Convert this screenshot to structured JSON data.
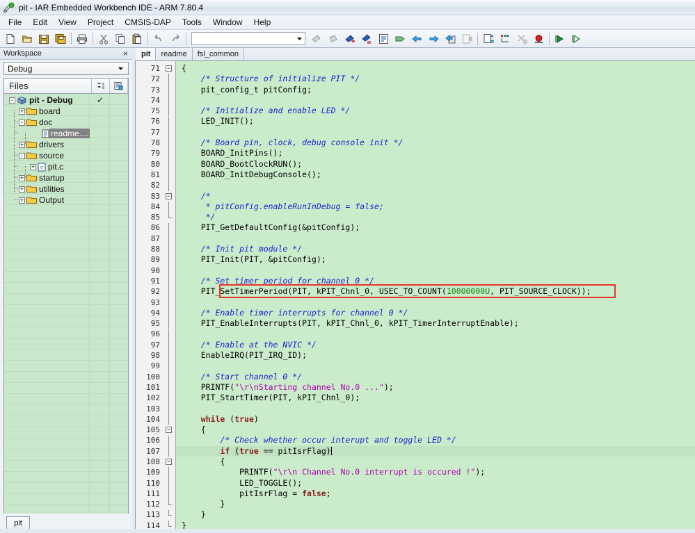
{
  "window": {
    "title": "pit - IAR Embedded Workbench IDE - ARM 7.80.4",
    "icon": "iar-app-icon"
  },
  "menu": {
    "items": [
      {
        "label": "File",
        "name": "menu-file"
      },
      {
        "label": "Edit",
        "name": "menu-edit"
      },
      {
        "label": "View",
        "name": "menu-view"
      },
      {
        "label": "Project",
        "name": "menu-project"
      },
      {
        "label": "CMSIS-DAP",
        "name": "menu-cmsis-dap"
      },
      {
        "label": "Tools",
        "name": "menu-tools"
      },
      {
        "label": "Window",
        "name": "menu-window"
      },
      {
        "label": "Help",
        "name": "menu-help"
      }
    ]
  },
  "toolbar": {
    "search_value": "",
    "search_placeholder": "",
    "buttons": [
      {
        "icon": "new-document-icon",
        "name": "toolbar-new"
      },
      {
        "icon": "open-folder-icon",
        "name": "toolbar-open"
      },
      {
        "icon": "save-icon",
        "name": "toolbar-save"
      },
      {
        "icon": "save-all-icon",
        "name": "toolbar-save-all"
      },
      {
        "icon": "print-icon",
        "name": "toolbar-print"
      },
      {
        "icon": "cut-scissors-icon",
        "name": "toolbar-cut"
      },
      {
        "icon": "copy-icon",
        "name": "toolbar-copy"
      },
      {
        "icon": "paste-icon",
        "name": "toolbar-paste"
      },
      {
        "icon": "undo-arrow-icon",
        "name": "toolbar-undo"
      },
      {
        "icon": "redo-arrow-icon",
        "name": "toolbar-redo"
      },
      {
        "icon": "bookmark-toggle-icon",
        "name": "toolbar-toggle-bookmark"
      },
      {
        "icon": "bookmark-prev-icon",
        "name": "toolbar-previous-bookmark"
      },
      {
        "icon": "breakpoint-add-icon",
        "name": "toolbar-toggle-breakpoint"
      },
      {
        "icon": "breakpoint-list-icon",
        "name": "toolbar-breakpoints"
      },
      {
        "icon": "compile-icon",
        "name": "toolbar-compile"
      },
      {
        "icon": "make-icon",
        "name": "toolbar-make"
      },
      {
        "icon": "navigate-back-icon",
        "name": "toolbar-navigate-backward"
      },
      {
        "icon": "navigate-forward-icon",
        "name": "toolbar-navigate-forward"
      },
      {
        "icon": "go-to-definition-icon",
        "name": "toolbar-go-to-definition"
      },
      {
        "icon": "next-statement-icon",
        "name": "toolbar-next-statement"
      },
      {
        "icon": "download-debug-icon",
        "name": "toolbar-download-and-debug"
      },
      {
        "icon": "debug-without-download-icon",
        "name": "toolbar-debug-without-downloading"
      },
      {
        "icon": "stop-build-icon",
        "name": "toolbar-stop-build"
      },
      {
        "icon": "stop-debug-icon",
        "name": "toolbar-stop-debugging"
      },
      {
        "icon": "run-icon",
        "name": "toolbar-run"
      },
      {
        "icon": "step-icon",
        "name": "toolbar-step"
      }
    ]
  },
  "workspace": {
    "panel_title": "Workspace",
    "close_label": "×",
    "configuration": "Debug",
    "columns": {
      "files": "Files",
      "col2_icon": "build-status-icon",
      "col3_icon": "file-overview-icon"
    },
    "tree": [
      {
        "label": "pit - Debug",
        "indent": 0,
        "expander": "-",
        "icon": "project-icon",
        "selected": false,
        "checked": true
      },
      {
        "label": "board",
        "indent": 1,
        "expander": "+",
        "icon": "folder-icon",
        "selected": false,
        "checked": false
      },
      {
        "label": "doc",
        "indent": 1,
        "expander": "-",
        "icon": "folder-icon",
        "selected": false,
        "checked": false
      },
      {
        "label": "readme....",
        "indent": 2,
        "expander": "",
        "icon": "document-icon",
        "selected": true,
        "checked": false
      },
      {
        "label": "drivers",
        "indent": 1,
        "expander": "+",
        "icon": "folder-icon",
        "selected": false,
        "checked": false
      },
      {
        "label": "source",
        "indent": 1,
        "expander": "-",
        "icon": "folder-icon",
        "selected": false,
        "checked": false
      },
      {
        "label": "pit.c",
        "indent": 2,
        "expander": "+",
        "icon": "c-source-icon",
        "selected": false,
        "checked": false
      },
      {
        "label": "startup",
        "indent": 1,
        "expander": "+",
        "icon": "folder-icon",
        "selected": false,
        "checked": false
      },
      {
        "label": "utilities",
        "indent": 1,
        "expander": "+",
        "icon": "folder-icon",
        "selected": false,
        "checked": false
      },
      {
        "label": "Output",
        "indent": 1,
        "expander": "+",
        "icon": "folder-icon",
        "selected": false,
        "checked": false
      }
    ],
    "bottom_tabs": [
      {
        "label": "pit",
        "active": true
      }
    ]
  },
  "editor": {
    "tabs": [
      {
        "label": "pit",
        "active": true
      },
      {
        "label": "readme",
        "active": false
      },
      {
        "label": "fsl_common",
        "active": false
      }
    ],
    "first_line": 71,
    "current_line": 107,
    "annotation": {
      "type": "red-rectangle",
      "around_line": 92
    },
    "lines": [
      {
        "n": 71,
        "fold": "minus",
        "segs": [
          {
            "t": "{",
            "c": ""
          }
        ],
        "indent": 0
      },
      {
        "n": 72,
        "fold": "bar",
        "segs": [
          {
            "t": "    /* Structure of initialize PIT */",
            "c": "cmt"
          }
        ]
      },
      {
        "n": 73,
        "fold": "bar",
        "segs": [
          {
            "t": "    pit_config_t pitConfig;",
            "c": ""
          }
        ]
      },
      {
        "n": 74,
        "fold": "bar",
        "segs": [
          {
            "t": "",
            "c": ""
          }
        ]
      },
      {
        "n": 75,
        "fold": "bar",
        "segs": [
          {
            "t": "    /* Initialize and enable LED */",
            "c": "cmt"
          }
        ]
      },
      {
        "n": 76,
        "fold": "bar",
        "segs": [
          {
            "t": "    LED_INIT();",
            "c": ""
          }
        ]
      },
      {
        "n": 77,
        "fold": "bar",
        "segs": [
          {
            "t": "",
            "c": ""
          }
        ]
      },
      {
        "n": 78,
        "fold": "bar",
        "segs": [
          {
            "t": "    /* Board pin, clock, debug console init */",
            "c": "cmt"
          }
        ]
      },
      {
        "n": 79,
        "fold": "bar",
        "segs": [
          {
            "t": "    BOARD_InitPins();",
            "c": ""
          }
        ]
      },
      {
        "n": 80,
        "fold": "bar",
        "segs": [
          {
            "t": "    BOARD_BootClockRUN();",
            "c": ""
          }
        ]
      },
      {
        "n": 81,
        "fold": "bar",
        "segs": [
          {
            "t": "    BOARD_InitDebugConsole();",
            "c": ""
          }
        ]
      },
      {
        "n": 82,
        "fold": "bar",
        "segs": [
          {
            "t": "",
            "c": ""
          }
        ]
      },
      {
        "n": 83,
        "fold": "minus",
        "segs": [
          {
            "t": "    /*",
            "c": "cmt"
          }
        ]
      },
      {
        "n": 84,
        "fold": "bar",
        "segs": [
          {
            "t": "     * pitConfig.enableRunInDebug = false;",
            "c": "cmt"
          }
        ]
      },
      {
        "n": 85,
        "fold": "tick",
        "segs": [
          {
            "t": "     */",
            "c": "cmt"
          }
        ]
      },
      {
        "n": 86,
        "fold": "bar",
        "segs": [
          {
            "t": "    PIT_GetDefaultConfig(&pitConfig);",
            "c": ""
          }
        ]
      },
      {
        "n": 87,
        "fold": "bar",
        "segs": [
          {
            "t": "",
            "c": ""
          }
        ]
      },
      {
        "n": 88,
        "fold": "bar",
        "segs": [
          {
            "t": "    /* Init pit module */",
            "c": "cmt"
          }
        ]
      },
      {
        "n": 89,
        "fold": "bar",
        "segs": [
          {
            "t": "    PIT_Init(PIT, &pitConfig);",
            "c": ""
          }
        ]
      },
      {
        "n": 90,
        "fold": "bar",
        "segs": [
          {
            "t": "",
            "c": ""
          }
        ]
      },
      {
        "n": 91,
        "fold": "bar",
        "segs": [
          {
            "t": "    /* Set timer period for channel 0 */",
            "c": "cmt"
          }
        ]
      },
      {
        "n": 92,
        "fold": "bar",
        "segs": [
          {
            "t": "    PIT_SetTimerPeriod(PIT, kPIT_Chnl_0, USEC_TO_COUNT(",
            "c": ""
          },
          {
            "t": "10000000U",
            "c": "num"
          },
          {
            "t": ", PIT_SOURCE_CLOCK));",
            "c": ""
          }
        ]
      },
      {
        "n": 93,
        "fold": "bar",
        "segs": [
          {
            "t": "",
            "c": ""
          }
        ]
      },
      {
        "n": 94,
        "fold": "bar",
        "segs": [
          {
            "t": "    /* Enable timer interrupts for channel 0 */",
            "c": "cmt"
          }
        ]
      },
      {
        "n": 95,
        "fold": "bar",
        "segs": [
          {
            "t": "    PIT_EnableInterrupts(PIT, kPIT_Chnl_0, kPIT_TimerInterruptEnable);",
            "c": ""
          }
        ]
      },
      {
        "n": 96,
        "fold": "bar",
        "segs": [
          {
            "t": "",
            "c": ""
          }
        ]
      },
      {
        "n": 97,
        "fold": "bar",
        "segs": [
          {
            "t": "    /* Enable at the NVIC */",
            "c": "cmt"
          }
        ]
      },
      {
        "n": 98,
        "fold": "bar",
        "segs": [
          {
            "t": "    EnableIRQ(PIT_IRQ_ID);",
            "c": ""
          }
        ]
      },
      {
        "n": 99,
        "fold": "bar",
        "segs": [
          {
            "t": "",
            "c": ""
          }
        ]
      },
      {
        "n": 100,
        "fold": "bar",
        "segs": [
          {
            "t": "    /* Start channel 0 */",
            "c": "cmt"
          }
        ]
      },
      {
        "n": 101,
        "fold": "bar",
        "segs": [
          {
            "t": "    PRINTF(",
            "c": ""
          },
          {
            "t": "\"\\r\\nStarting channel No.0 ...\"",
            "c": "str"
          },
          {
            "t": ");",
            "c": ""
          }
        ]
      },
      {
        "n": 102,
        "fold": "bar",
        "segs": [
          {
            "t": "    PIT_StartTimer(PIT, kPIT_Chnl_0);",
            "c": ""
          }
        ]
      },
      {
        "n": 103,
        "fold": "bar",
        "segs": [
          {
            "t": "",
            "c": ""
          }
        ]
      },
      {
        "n": 104,
        "fold": "bar",
        "segs": [
          {
            "t": "    ",
            "c": ""
          },
          {
            "t": "while",
            "c": "kw"
          },
          {
            "t": " (",
            "c": ""
          },
          {
            "t": "true",
            "c": "kw"
          },
          {
            "t": ")",
            "c": ""
          }
        ]
      },
      {
        "n": 105,
        "fold": "minus",
        "segs": [
          {
            "t": "    {",
            "c": ""
          }
        ]
      },
      {
        "n": 106,
        "fold": "bar",
        "segs": [
          {
            "t": "        /* Check whether occur interupt and toggle LED */",
            "c": "cmt"
          }
        ]
      },
      {
        "n": 107,
        "fold": "bar",
        "current": true,
        "segs": [
          {
            "t": "        ",
            "c": ""
          },
          {
            "t": "if",
            "c": "kw"
          },
          {
            "t": " ",
            "c": ""
          },
          {
            "t": "(",
            "c": "paren-hl"
          },
          {
            "t": "true",
            "c": "kw"
          },
          {
            "t": " == pitIsrFlag",
            "c": ""
          },
          {
            "t": ")",
            "c": "paren-hl"
          },
          {
            "t": "|CARET|",
            "c": "caret"
          }
        ]
      },
      {
        "n": 108,
        "fold": "minus",
        "segs": [
          {
            "t": "        {",
            "c": ""
          }
        ]
      },
      {
        "n": 109,
        "fold": "bar",
        "segs": [
          {
            "t": "            PRINTF(",
            "c": ""
          },
          {
            "t": "\"\\r\\n Channel No.0 interrupt is occured !\"",
            "c": "str"
          },
          {
            "t": ");",
            "c": ""
          }
        ]
      },
      {
        "n": 110,
        "fold": "bar",
        "segs": [
          {
            "t": "            LED_TOGGLE();",
            "c": ""
          }
        ]
      },
      {
        "n": 111,
        "fold": "bar",
        "segs": [
          {
            "t": "            pitIsrFlag = ",
            "c": ""
          },
          {
            "t": "false",
            "c": "kw"
          },
          {
            "t": ";",
            "c": ""
          }
        ]
      },
      {
        "n": 112,
        "fold": "tick",
        "segs": [
          {
            "t": "        }",
            "c": ""
          }
        ]
      },
      {
        "n": 113,
        "fold": "tick",
        "segs": [
          {
            "t": "    }",
            "c": ""
          }
        ]
      },
      {
        "n": 114,
        "fold": "tick",
        "segs": [
          {
            "t": "}",
            "c": ""
          }
        ]
      }
    ]
  },
  "colors": {
    "code_background": "#cbecca",
    "current_line": "#c2e3c1",
    "comment": "#2020d0",
    "keyword": "#8b1a1a",
    "string": "#b000b0",
    "number": "#108010",
    "annotation_red": "#e8342a",
    "tree_background": "#c9e7ca",
    "selection_gray": "#808080"
  }
}
